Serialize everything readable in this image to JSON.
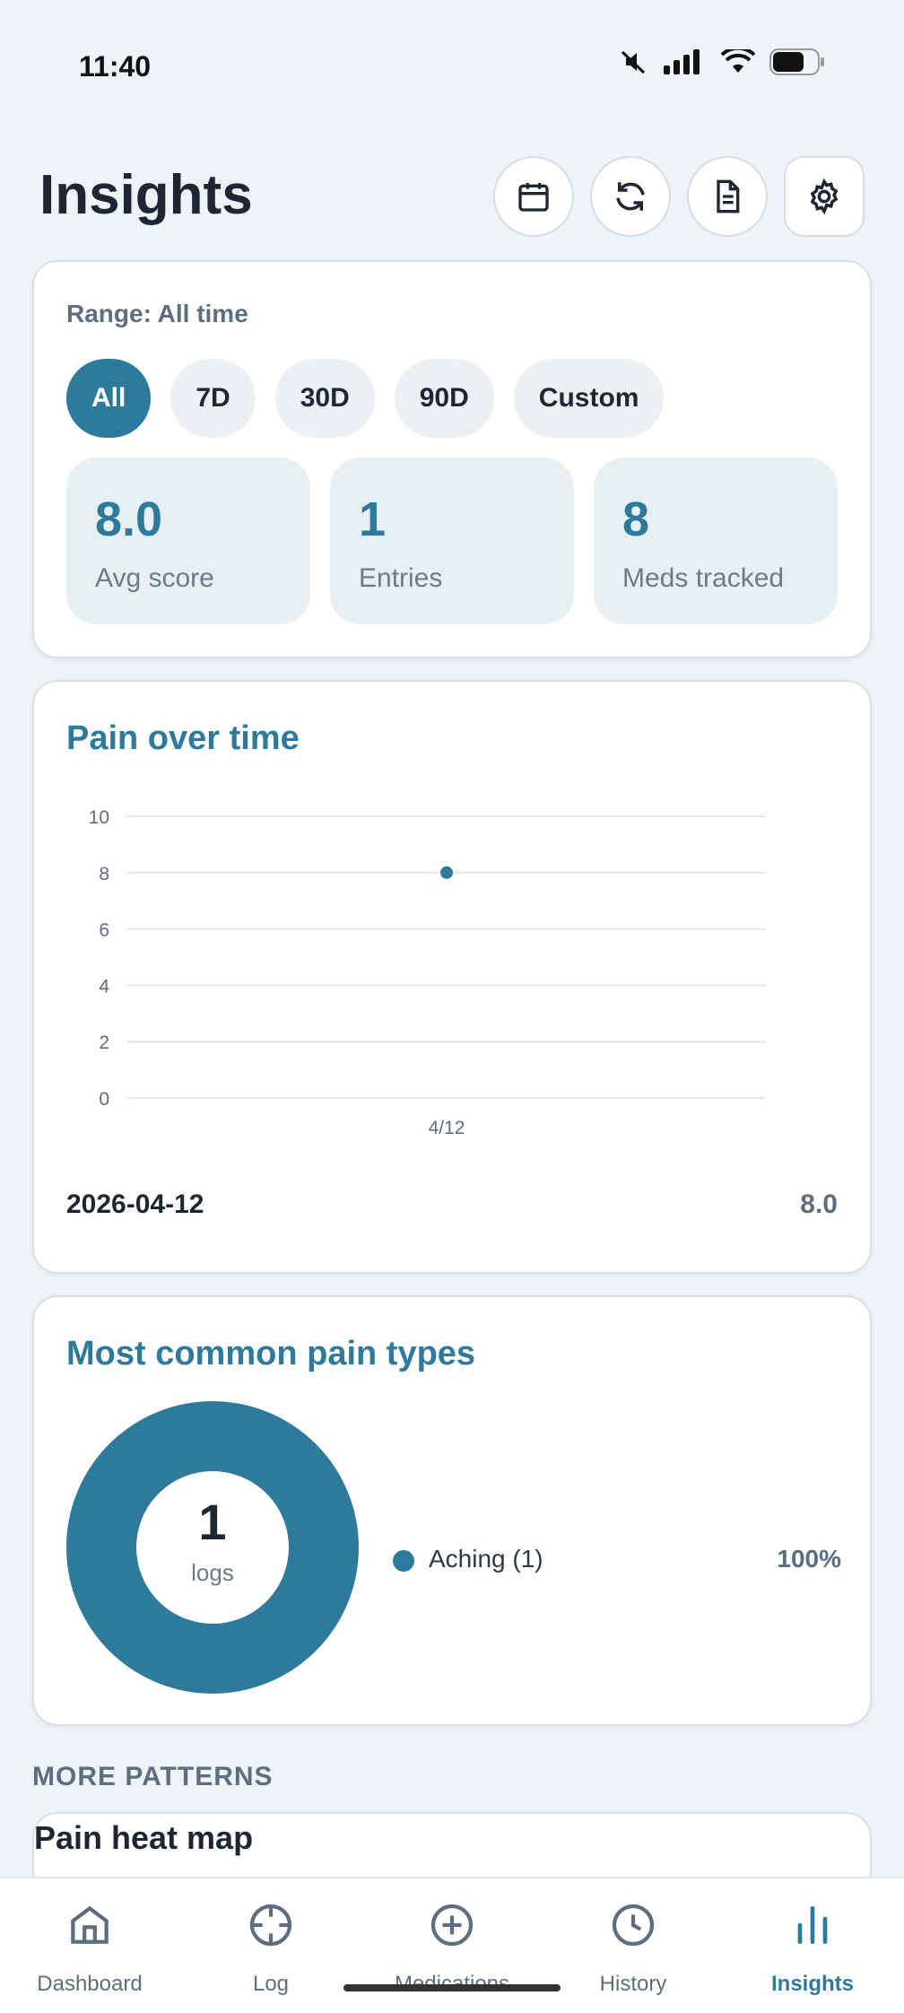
{
  "status": {
    "time": "11:40"
  },
  "header": {
    "title": "Insights",
    "buttons": [
      "calendar-icon",
      "refresh-icon",
      "document-icon",
      "gear-icon"
    ]
  },
  "range": {
    "label": "Range: All time",
    "options": [
      "All",
      "7D",
      "30D",
      "90D",
      "Custom"
    ],
    "selected": "All"
  },
  "stats": [
    {
      "value": "8.0",
      "label": "Avg score"
    },
    {
      "value": "1",
      "label": "Entries"
    },
    {
      "value": "8",
      "label": "Meds tracked"
    }
  ],
  "pain_over_time": {
    "title": "Pain over time",
    "latest_date": "2026-04-12",
    "latest_value": "8.0"
  },
  "pain_types": {
    "title": "Most common pain types",
    "center_value": "1",
    "center_label": "logs",
    "items": [
      {
        "label": "Aching (1)",
        "percent": "100%"
      }
    ]
  },
  "more_patterns": {
    "label": "MORE PATTERNS",
    "heatmap_title": "Pain heat map"
  },
  "tabs": [
    {
      "label": "Dashboard",
      "icon": "home-icon"
    },
    {
      "label": "Log",
      "icon": "crosshair-icon"
    },
    {
      "label": "Medications",
      "icon": "plus-circle-icon"
    },
    {
      "label": "History",
      "icon": "clock-icon"
    },
    {
      "label": "Insights",
      "icon": "bar-chart-icon"
    }
  ],
  "colors": {
    "accent": "#2e7a9c",
    "background": "#eef3f7",
    "text": "#1d2733",
    "muted": "#5c6e80"
  },
  "chart_data": [
    {
      "type": "scatter",
      "title": "Pain over time",
      "x": [
        "4/12"
      ],
      "y": [
        8
      ],
      "ylim": [
        0,
        10
      ],
      "yticks": [
        0,
        2,
        4,
        6,
        8,
        10
      ],
      "grid": true
    },
    {
      "type": "pie",
      "title": "Most common pain types",
      "labels": [
        "Aching (1)"
      ],
      "values": [
        1
      ],
      "percentages": [
        "100%"
      ]
    }
  ]
}
